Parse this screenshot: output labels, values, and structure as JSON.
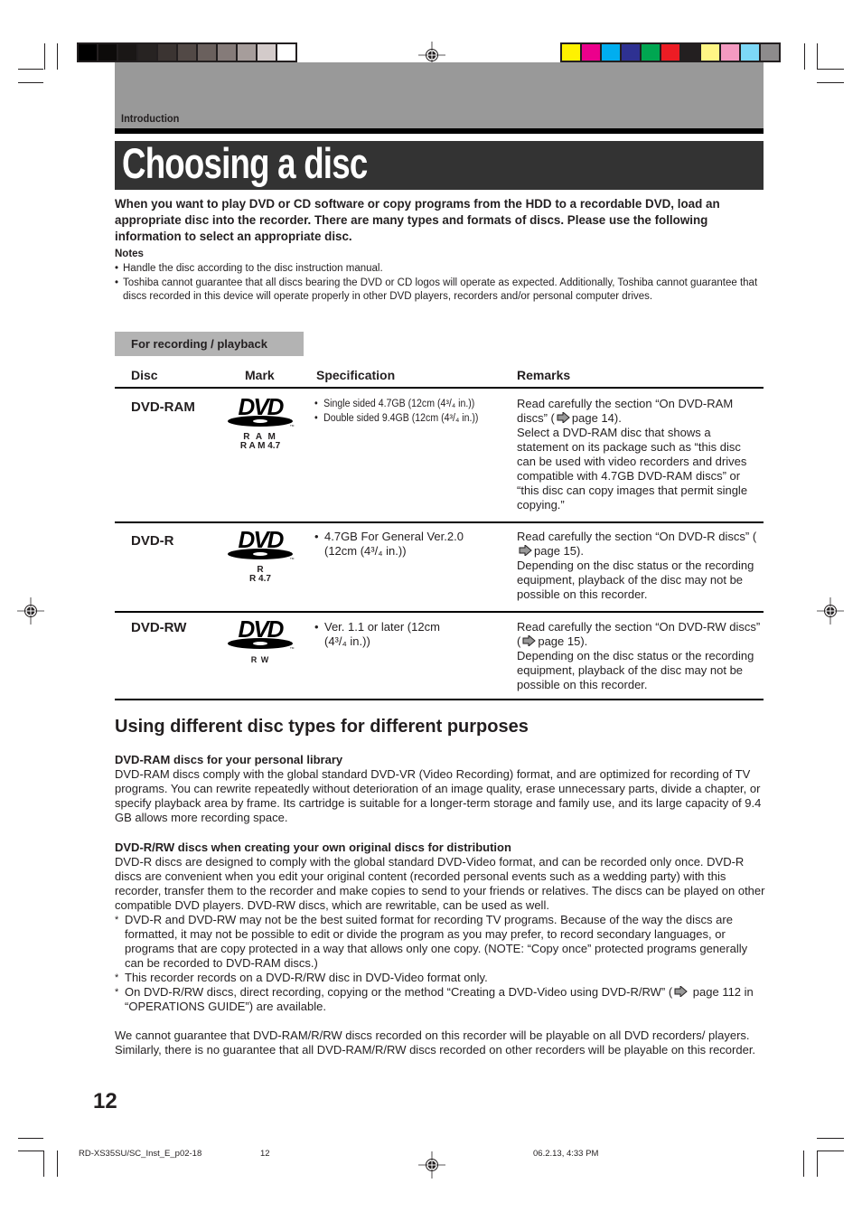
{
  "print_marks": {
    "grayscale_swatches": [
      "#000000",
      "#0d0b0a",
      "#1a1716",
      "#272322",
      "#3b3432",
      "#524946",
      "#6a605d",
      "#857b79",
      "#a69d9b",
      "#d3cbca",
      "#ffffff"
    ],
    "color_swatches": [
      "#fff200",
      "#ec008c",
      "#00aeef",
      "#2e3192",
      "#00a651",
      "#ed1c24",
      "#231f20",
      "#fff685",
      "#f49ac1",
      "#7dd8f7",
      "#8d8b8c"
    ]
  },
  "header": {
    "section": "Introduction",
    "title": "Choosing a disc"
  },
  "intro": "When you want to play DVD or CD software or copy programs from the HDD to a recordable DVD, load an appropriate disc into the recorder. There are many types and formats of discs. Please use the following information to select an appropriate disc.",
  "notes": {
    "title": "Notes",
    "items": [
      "Handle the disc according to the disc instruction manual.",
      "Toshiba cannot guarantee that all discs bearing the DVD or CD logos will operate as expected. Additionally, Toshiba cannot guarantee that discs recorded in this device will operate properly in other DVD players, recorders and/or personal computer drives."
    ]
  },
  "disc_table": {
    "tab_label": "For recording / playback",
    "columns": [
      "Disc",
      "Mark",
      "Specification",
      "Remarks"
    ],
    "rows": [
      {
        "disc": "DVD-RAM",
        "mark_lines": [
          "R A M",
          "R A M 4.7"
        ],
        "spec": [
          "Single sided 4.7GB (12cm (4³/₄ in.))",
          "Double sided 9.4GB (12cm (4³/₄ in.))"
        ],
        "remarks_pre": "Read carefully the section “On DVD-RAM discs” (",
        "remarks_ref": "page 14).",
        "remarks_post": "Select a DVD-RAM disc that shows a statement on its package such as “this disc can be used with video recorders and drives compatible with 4.7GB DVD-RAM discs” or “this disc can copy images that permit single copying.”"
      },
      {
        "disc": "DVD-R",
        "mark_lines": [
          "R",
          "R 4.7"
        ],
        "spec": [
          "4.7GB For General Ver.2.0 (12cm (4³/₄ in.))"
        ],
        "remarks_pre": "Read carefully the section “On DVD-R discs” (",
        "remarks_ref": "page 15).",
        "remarks_post": "Depending on the disc status or the recording equipment, playback of the disc may not be possible on this recorder."
      },
      {
        "disc": "DVD-RW",
        "mark_lines": [
          "R W"
        ],
        "spec": [
          "Ver. 1.1 or later (12cm (4³/₄ in.))"
        ],
        "remarks_pre": "Read carefully the section “On DVD-RW discs” (",
        "remarks_ref": "page 15).",
        "remarks_post": "Depending on the disc status or the recording equipment, playback of the disc may not be possible on this recorder."
      }
    ]
  },
  "purposes": {
    "heading": "Using different disc types for different purposes",
    "ram_heading": "DVD-RAM discs for your personal library",
    "ram_text": "DVD-RAM discs comply with the global standard DVD-VR (Video Recording) format, and are optimized for recording of TV programs. You can rewrite repeatedly without deterioration of an image quality, erase unnecessary parts, divide a chapter, or specify playback area by frame. Its cartridge is suitable for a longer-term storage and family use, and its large capacity of 9.4 GB allows more recording space.",
    "rrw_heading": "DVD-R/RW discs when creating your own original discs for distribution",
    "rrw_text": "DVD-R discs are designed to comply with the global standard DVD-Video format, and can be recorded only once. DVD-R discs are convenient when you edit your original content (recorded personal events such as a wedding party) with this recorder, transfer them to the recorder and make copies to send to your friends or relatives. The discs can be played on other compatible DVD players. DVD-RW discs, which are rewritable, can be used as well.",
    "star_notes": [
      "DVD-R and DVD-RW may not be the best suited format for recording TV programs.  Because of the way the discs are formatted, it may not be possible to edit or divide the program as you may prefer, to record secondary languages, or programs that are copy protected in a way that allows only one copy.  (NOTE: “Copy once” protected programs generally can be recorded to DVD-RAM discs.)",
      "This recorder records on a DVD-R/RW disc in DVD-Video format only."
    ],
    "star_last_pre": "On DVD-R/RW discs, direct recording, copying or the method “Creating a DVD-Video using DVD-R/RW” (",
    "star_last_post": " page 112 in “OPERATIONS GUIDE”) are available.",
    "disclaimer": "We cannot guarantee that DVD-RAM/R/RW discs recorded on this recorder will be playable on all DVD recorders/ players. Similarly, there is no guarantee that all DVD-RAM/R/RW discs recorded on other recorders will be playable on this recorder."
  },
  "footer": {
    "page_number": "12",
    "slug_file": "RD-XS35SU/SC_Inst_E_p02-18",
    "slug_page": "12",
    "slug_date": "06.2.13, 4:33 PM"
  }
}
